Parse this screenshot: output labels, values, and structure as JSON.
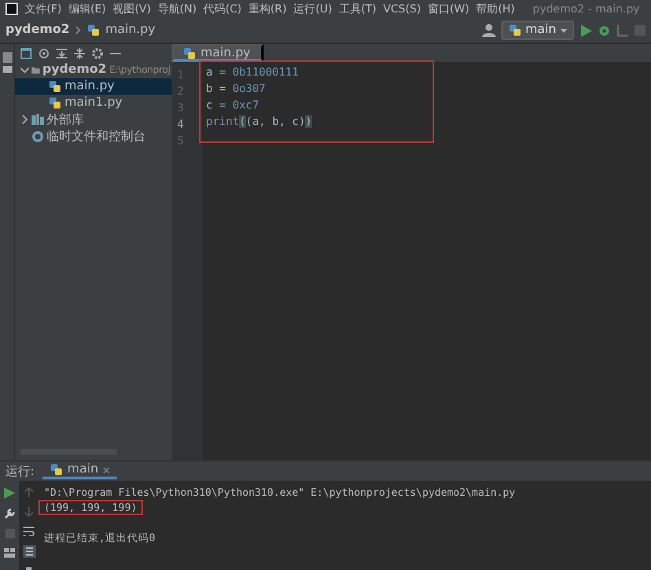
{
  "menu": [
    "文件(F)",
    "编辑(E)",
    "视图(V)",
    "导航(N)",
    "代码(C)",
    "重构(R)",
    "运行(U)",
    "工具(T)",
    "VCS(S)",
    "窗口(W)",
    "帮助(H)"
  ],
  "window": {
    "title": "pydemo2 - main.py"
  },
  "breadcrumb": [
    "pydemo2",
    "main.py"
  ],
  "run_config": "main",
  "project_tree": [
    {
      "label": "pydemo2",
      "path": "E:\\pythonproj",
      "kind": "folder",
      "expanded": true,
      "selected": false,
      "children": [
        {
          "label": "main.py",
          "kind": "python",
          "selected": true
        },
        {
          "label": "main1.py",
          "kind": "python",
          "selected": false
        }
      ]
    },
    {
      "label": "外部库",
      "kind": "library",
      "expanded": false,
      "selected": false
    },
    {
      "label": "临时文件和控制台",
      "kind": "console",
      "selected": false
    }
  ],
  "editor": {
    "tab": "main.py",
    "highlighted": true,
    "lines": [
      {
        "number": "1",
        "tokens": [
          {
            "kind": "name",
            "text": "a = "
          },
          {
            "kind": "number",
            "text": "0b11000111"
          }
        ]
      },
      {
        "number": "2",
        "tokens": [
          {
            "kind": "name",
            "text": "b = "
          },
          {
            "kind": "number",
            "text": "0o307"
          }
        ]
      },
      {
        "number": "3",
        "tokens": [
          {
            "kind": "name",
            "text": "c = "
          },
          {
            "kind": "number",
            "text": "0xc7"
          }
        ]
      },
      {
        "number": "4",
        "tokens": [
          {
            "kind": "builtin",
            "text": "print"
          },
          {
            "kind": "brace",
            "text": "("
          },
          {
            "kind": "name",
            "text": "(a, b, c)"
          },
          {
            "kind": "brace",
            "text": ")"
          }
        ]
      },
      {
        "number": "5"
      }
    ]
  },
  "run": {
    "label": "运行:",
    "tab": "main",
    "output": [
      {
        "kind": "command",
        "text": "\"D:\\Program Files\\Python310\\Python310.exe\" E:\\pythonprojects\\pydemo2\\main.py",
        "highlighted": false
      },
      {
        "kind": "output",
        "text": "(199, 199, 199)",
        "highlighted": true
      },
      {
        "kind": "status",
        "text": "进程已结束,退出代码0",
        "highlighted": false
      }
    ]
  }
}
